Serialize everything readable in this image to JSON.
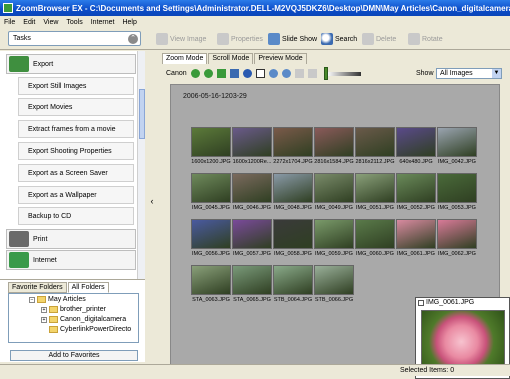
{
  "window": {
    "title": "ZoomBrowser EX - C:\\Documents and Settings\\Administrator.DELL-M2VQJ5DKZ6\\Desktop\\DMN\\May Articles\\Canon_digitalcamera"
  },
  "menu": [
    "File",
    "Edit",
    "View",
    "Tools",
    "Internet",
    "Help"
  ],
  "toolbar": {
    "tasks_label": "Tasks",
    "view_image": "View Image",
    "properties": "Properties",
    "slide_show": "Slide Show",
    "search": "Search",
    "delete": "Delete",
    "rotate": "Rotate"
  },
  "tasks": {
    "export_group": "Export",
    "items": [
      "Export Still Images",
      "Export Movies",
      "Extract frames from a movie",
      "Export Shooting Properties",
      "Export as a Screen Saver",
      "Export as a Wallpaper",
      "Backup to CD"
    ],
    "print_group": "Print",
    "internet_group": "Internet"
  },
  "folders": {
    "tabs": [
      "Favorite Folders",
      "All Folders"
    ],
    "tree": [
      {
        "label": "May Articles",
        "expander": "−"
      },
      {
        "label": "brother_printer",
        "expander": "+"
      },
      {
        "label": "Canon_digitalcamera",
        "expander": "+"
      },
      {
        "label": "CyberlinkPowerDirecto",
        "expander": ""
      }
    ],
    "add_to_favorites": "Add to Favorites"
  },
  "main": {
    "tabs": [
      "Zoom Mode",
      "Scroll Mode",
      "Preview Mode"
    ],
    "camera_label": "Canon",
    "show_label": "Show",
    "show_value": "All Images",
    "date_label": "2006-05-16-1203-29",
    "thumbnails": [
      {
        "caption": "1600x1200.JPG",
        "color": "#5c7a3a"
      },
      {
        "caption": "1600x1200Re...",
        "color": "#6a5a8a"
      },
      {
        "caption": "2272x1704.JPG",
        "color": "#7a5a4a"
      },
      {
        "caption": "2816x1584.JPG",
        "color": "#8a5a5a"
      },
      {
        "caption": "2816x2112.JPG",
        "color": "#6a5a4a"
      },
      {
        "caption": "640x480.JPG",
        "color": "#5a4a8a"
      },
      {
        "caption": "IMG_0042.JPG",
        "color": "#9aa4b0"
      },
      {
        "caption": "IMG_0045.JPG",
        "color": "#6f8a5c"
      },
      {
        "caption": "IMG_0046.JPG",
        "color": "#7b6a5e"
      },
      {
        "caption": "IMG_0048.JPG",
        "color": "#8a9aa8"
      },
      {
        "caption": "IMG_0049.JPG",
        "color": "#7a8b6a"
      },
      {
        "caption": "IMG_0051.JPG",
        "color": "#8aa07a"
      },
      {
        "caption": "IMG_0052.JPG",
        "color": "#6a8a5a"
      },
      {
        "caption": "IMG_0053.JPG",
        "color": "#4a6a3a"
      },
      {
        "caption": "IMG_0056.JPG",
        "color": "#4a5aa0"
      },
      {
        "caption": "IMG_0057.JPG",
        "color": "#7a4a9a"
      },
      {
        "caption": "IMG_0058.JPG",
        "color": "#3a3a3a"
      },
      {
        "caption": "IMG_0059.JPG",
        "color": "#7a9a6a"
      },
      {
        "caption": "IMG_0060.JPG",
        "color": "#5a7a4a"
      },
      {
        "caption": "IMG_0061.JPG",
        "color": "#d88aa0"
      },
      {
        "caption": "IMG_0062.JPG",
        "color": "#d87a98"
      },
      {
        "caption": "STA_0063.JPG",
        "color": "#8aa07a"
      },
      {
        "caption": "STA_0065.JPG",
        "color": "#7a9a7a"
      },
      {
        "caption": "STB_0064.JPG",
        "color": "#8aaa8a"
      },
      {
        "caption": "STB_0066.JPG",
        "color": "#9ab09a"
      }
    ],
    "preview_label": "IMG_0061.JPG"
  },
  "status": {
    "selected": "Selected Items: 0"
  },
  "colors": {
    "title_bar": "#0b4cc8",
    "browse_bg": "#a9a9a9"
  }
}
